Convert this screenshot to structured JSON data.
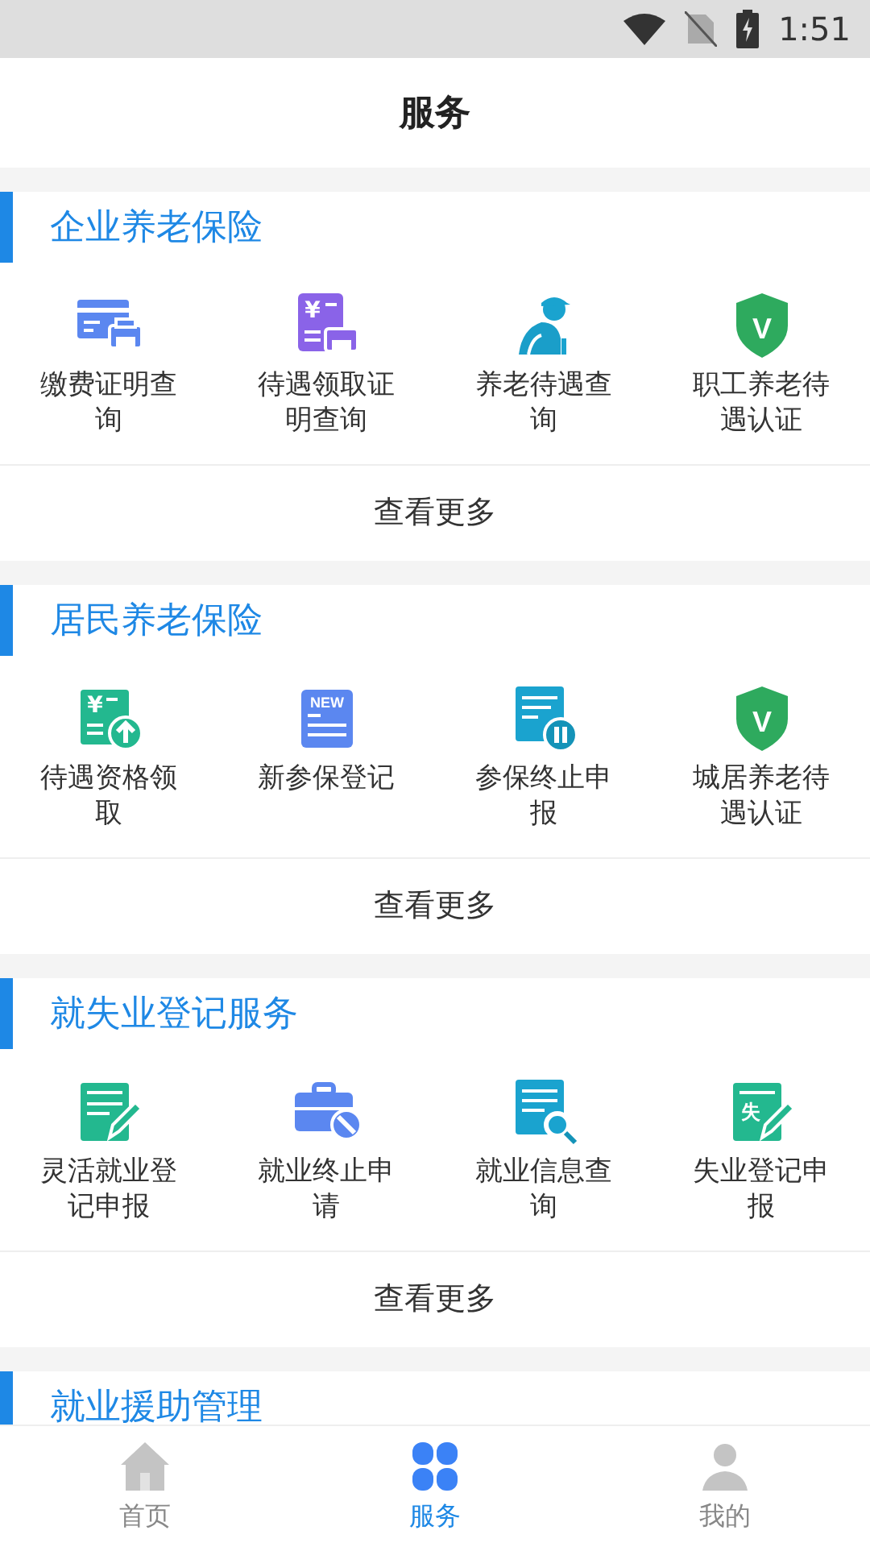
{
  "status_bar": {
    "time": "1:51"
  },
  "header": {
    "title": "服务"
  },
  "sections": [
    {
      "title": "企业养老保险",
      "items": [
        {
          "kind": "card-printer",
          "label": "缴费证明查询"
        },
        {
          "kind": "yen-printer",
          "icon_text": "¥",
          "label": "待遇领取证明查询"
        },
        {
          "kind": "elderly",
          "label": "养老待遇查询"
        },
        {
          "kind": "shield",
          "icon_text": "V",
          "label": "职工养老待遇认证"
        }
      ],
      "more": "查看更多"
    },
    {
      "title": "居民养老保险",
      "items": [
        {
          "kind": "yen-upload",
          "icon_text": "¥",
          "label": "待遇资格领取"
        },
        {
          "kind": "new-doc",
          "icon_text": "NEW",
          "label": "新参保登记"
        },
        {
          "kind": "doc-pause",
          "label": "参保终止申报"
        },
        {
          "kind": "shield",
          "icon_text": "V",
          "label": "城居养老待遇认证"
        }
      ],
      "more": "查看更多"
    },
    {
      "title": "就失业登记服务",
      "items": [
        {
          "kind": "doc-pencil",
          "label": "灵活就业登记申报"
        },
        {
          "kind": "briefcase-ban",
          "label": "就业终止申请"
        },
        {
          "kind": "doc-search",
          "label": "就业信息查询"
        },
        {
          "kind": "doc-pencil",
          "icon_text": "失",
          "label": "失业登记申报"
        }
      ],
      "more": "查看更多"
    },
    {
      "title": "就业援助管理"
    }
  ],
  "tabs": [
    {
      "kind": "home",
      "label": "首页",
      "selected": false
    },
    {
      "kind": "services",
      "label": "服务",
      "selected": true
    },
    {
      "kind": "profile",
      "label": "我的",
      "selected": false
    }
  ]
}
